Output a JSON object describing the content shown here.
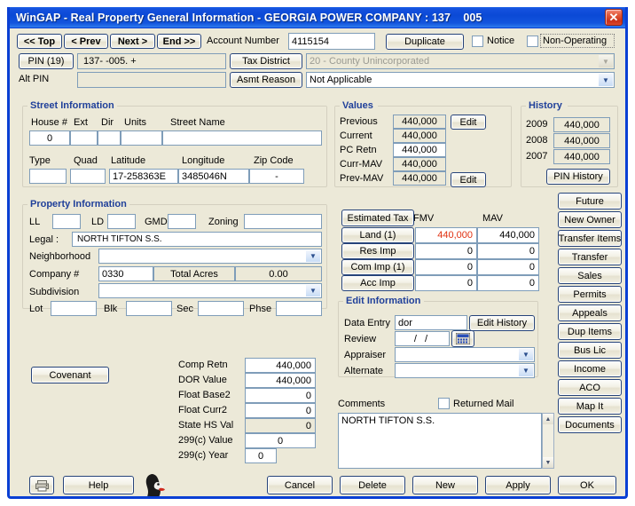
{
  "window": {
    "title": "WinGAP - Real Property General Information - GEORGIA POWER COMPANY : 137    005",
    "close_label": "✕"
  },
  "nav": {
    "top": "<< Top",
    "prev": "< Prev",
    "next": "Next >",
    "end": "End >>"
  },
  "account": {
    "label": "Account Number",
    "value": "4115154",
    "duplicate_label": "Duplicate",
    "notice_label": "Notice",
    "notice_checked": false,
    "non_operating_label": "Non-Operating",
    "non_operating_checked": false
  },
  "pin": {
    "button_label": "PIN (19)",
    "value": "137-    -005.  +",
    "tax_district_label": "Tax District",
    "tax_district_value": "20 - County Unincorporated",
    "alt_pin_label": "Alt PIN",
    "alt_pin_value": "",
    "asmt_reason_label": "Asmt Reason",
    "asmt_reason_value": "Not Applicable"
  },
  "street": {
    "title": "Street Information",
    "headers": [
      "House #",
      "Ext",
      "Dir",
      "Units",
      "Street Name"
    ],
    "values": [
      "0",
      "",
      "",
      "",
      ""
    ],
    "headers2": [
      "Type",
      "Quad",
      "Latitude",
      "Longitude",
      "Zip Code"
    ],
    "values2": [
      "",
      "",
      "17-258363E",
      "3485046N",
      "-"
    ]
  },
  "property": {
    "title": "Property Information",
    "ll_label": "LL",
    "ll_value": "",
    "ld_label": "LD",
    "ld_value": "",
    "gmd_label": "GMD",
    "gmd_value": "",
    "zoning_label": "Zoning",
    "zoning_value": "",
    "legal_label": "Legal :",
    "legal_value": "NORTH TIFTON S.S.",
    "neighborhood_label": "Neighborhood",
    "neighborhood_value": "",
    "company_label": "Company #",
    "company_value": "0330",
    "total_acres_label": "Total Acres",
    "total_acres_value": "0.00",
    "subdivision_label": "Subdivision",
    "subdivision_value": "",
    "lot_label": "Lot",
    "lot_value": "",
    "blk_label": "Blk",
    "blk_value": "",
    "sec_label": "Sec",
    "sec_value": "",
    "phse_label": "Phse",
    "phse_value": ""
  },
  "covenant": {
    "label": "Covenant"
  },
  "comp": {
    "rows": [
      {
        "label": "Comp Retn",
        "value": "440,000",
        "readonly": false,
        "center": false
      },
      {
        "label": "DOR Value",
        "value": "440,000",
        "readonly": false,
        "center": false
      },
      {
        "label": "Float Base2",
        "value": "0",
        "readonly": false,
        "center": false
      },
      {
        "label": "Float Curr2",
        "value": "0",
        "readonly": false,
        "center": false
      },
      {
        "label": "State HS Val",
        "value": "0",
        "readonly": true,
        "center": false
      },
      {
        "label": "299(c) Value",
        "value": "0",
        "readonly": false,
        "center": true
      },
      {
        "label": "299(c) Year",
        "value": "0",
        "readonly": false,
        "center": true
      }
    ]
  },
  "values": {
    "title": "Values",
    "rows": [
      {
        "label": "Previous",
        "value": "440,000",
        "readonly": true
      },
      {
        "label": "Current",
        "value": "440,000",
        "readonly": true
      },
      {
        "label": "PC Retn",
        "value": "440,000",
        "readonly": false
      },
      {
        "label": "Curr-MAV",
        "value": "440,000",
        "readonly": true
      },
      {
        "label": "Prev-MAV",
        "value": "440,000",
        "readonly": true
      }
    ],
    "edit_label_top": "Edit",
    "edit_label_bottom": "Edit"
  },
  "history": {
    "title": "History",
    "rows": [
      {
        "year": "2009",
        "value": "440,000"
      },
      {
        "year": "2008",
        "value": "440,000"
      },
      {
        "year": "2007",
        "value": "440,000"
      }
    ],
    "pin_history_label": "PIN History"
  },
  "tax_grid": {
    "estimated_tax_label": "Estimated Tax",
    "col_fmv": "FMV",
    "col_mav": "MAV",
    "rows": [
      {
        "label": "Land (1)",
        "fmv": "440,000",
        "mav": "440,000",
        "fmv_color": "#e03010"
      },
      {
        "label": "Res Imp",
        "fmv": "0",
        "mav": "0",
        "fmv_color": "#000000"
      },
      {
        "label": "Com Imp (1)",
        "fmv": "0",
        "mav": "0",
        "fmv_color": "#000000"
      },
      {
        "label": "Acc Imp",
        "fmv": "0",
        "mav": "0",
        "fmv_color": "#000000"
      }
    ]
  },
  "edit_info": {
    "title": "Edit Information",
    "data_entry_label": "Data Entry",
    "data_entry_value": "dor",
    "edit_history_label": "Edit History",
    "review_label": "Review",
    "review_value": "/  /",
    "calendar_icon": "calendar-icon",
    "appraiser_label": "Appraiser",
    "appraiser_value": "",
    "alternate_label": "Alternate",
    "alternate_value": ""
  },
  "comments": {
    "label": "Comments",
    "returned_mail_label": "Returned Mail",
    "returned_mail_checked": false,
    "text": "NORTH TIFTON S.S."
  },
  "side_buttons": [
    "Future",
    "New Owner",
    "Transfer Items",
    "Transfer",
    "Sales",
    "Permits",
    "Appeals",
    "Dup Items",
    "Bus Lic",
    "Income",
    "ACO",
    "Map It",
    "Documents"
  ],
  "footer": {
    "print_icon": "printer-icon",
    "help_label": "Help",
    "mascot_icon": "mascot-icon",
    "cancel_label": "Cancel",
    "delete_label": "Delete",
    "new_label": "New",
    "apply_label": "Apply",
    "ok_label": "OK"
  }
}
